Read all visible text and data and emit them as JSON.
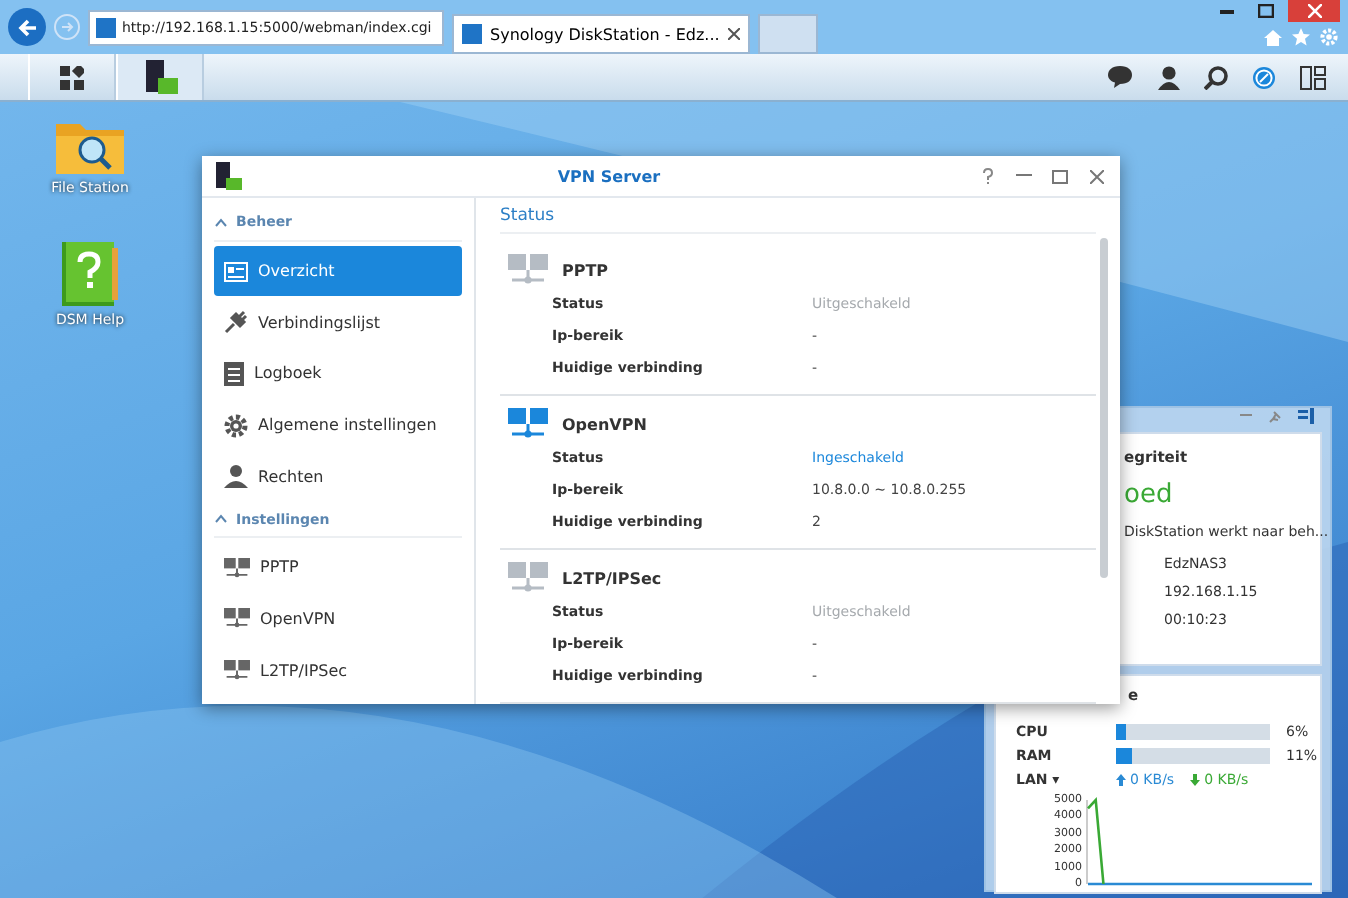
{
  "browser": {
    "address": "http://192.168.1.15:5000/webman/index.cgi",
    "tabs": [
      {
        "title": "Synology DiskStation - Edz...",
        "selected": true
      }
    ]
  },
  "desktop_icons": [
    {
      "label": "File Station",
      "kind": "folder"
    },
    {
      "label": "DSM Help",
      "kind": "help"
    }
  ],
  "window": {
    "title": "VPN Server",
    "sidebar": [
      {
        "section": "Beheer",
        "expanded": true,
        "items": [
          {
            "label": "Overzicht",
            "kind": "overview",
            "selected": true
          },
          {
            "label": "Verbindingslijst",
            "kind": "plug",
            "selected": false
          },
          {
            "label": "Logboek",
            "kind": "log",
            "selected": false
          },
          {
            "label": "Algemene instellingen",
            "kind": "gear",
            "selected": false
          },
          {
            "label": "Rechten",
            "kind": "user",
            "selected": false
          }
        ]
      },
      {
        "section": "Instellingen",
        "expanded": true,
        "items": [
          {
            "label": "PPTP",
            "kind": "network",
            "selected": false
          },
          {
            "label": "OpenVPN",
            "kind": "network",
            "selected": false
          },
          {
            "label": "L2TP/IPSec",
            "kind": "network",
            "selected": false
          }
        ]
      }
    ],
    "content_title": "Status",
    "services": [
      {
        "name": "PPTP",
        "enabled": false,
        "rows": [
          {
            "label": "Status",
            "value": "Uitgeschakeld"
          },
          {
            "label": "Ip-bereik",
            "value": "-"
          },
          {
            "label": "Huidige verbinding",
            "value": "-"
          }
        ]
      },
      {
        "name": "OpenVPN",
        "enabled": true,
        "rows": [
          {
            "label": "Status",
            "value": "Ingeschakeld"
          },
          {
            "label": "Ip-bereik",
            "value": "10.8.0.0 ~ 10.8.0.255"
          },
          {
            "label": "Huidige verbinding",
            "value": "2"
          }
        ]
      },
      {
        "name": "L2TP/IPSec",
        "enabled": false,
        "rows": [
          {
            "label": "Status",
            "value": "Uitgeschakeld"
          },
          {
            "label": "Ip-bereik",
            "value": "-"
          },
          {
            "label": "Huidige verbinding",
            "value": "-"
          }
        ]
      }
    ]
  },
  "widget": {
    "health": {
      "title": "egriteit",
      "status": "oed",
      "message": "DiskStation werkt naar beh...",
      "values": [
        "EdzNAS3",
        "192.168.1.15",
        "00:10:23"
      ]
    },
    "resource": {
      "title": "e",
      "meters": [
        {
          "label": "CPU",
          "level": 0.06,
          "reading": "6%"
        },
        {
          "label": "RAM",
          "level": 0.11,
          "reading": "11%"
        }
      ],
      "lan_label": "LAN ▾",
      "upload": "0 KB/s",
      "download": "0 KB/s",
      "chart_data": {
        "type": "line",
        "ylim": [
          0,
          5000
        ],
        "yticks": [
          0,
          1000,
          2000,
          3000,
          4000,
          5000
        ],
        "series": [
          {
            "color": "#3aa935",
            "values": [
              4500,
              5000,
              0,
              null,
              null,
              null,
              null,
              null,
              null,
              null,
              null,
              null,
              null,
              null,
              null,
              null,
              null,
              null,
              null,
              null,
              null,
              null,
              null,
              null,
              null,
              null,
              null,
              null,
              null,
              null
            ]
          },
          {
            "color": "#2a8ad4",
            "values": [
              0,
              0,
              0,
              0,
              0,
              0,
              0,
              0,
              0,
              0,
              0,
              0,
              0,
              0,
              0,
              0,
              0,
              0,
              0,
              0,
              0,
              0,
              0,
              0,
              0,
              0,
              0,
              0,
              0,
              0
            ]
          }
        ]
      }
    }
  }
}
